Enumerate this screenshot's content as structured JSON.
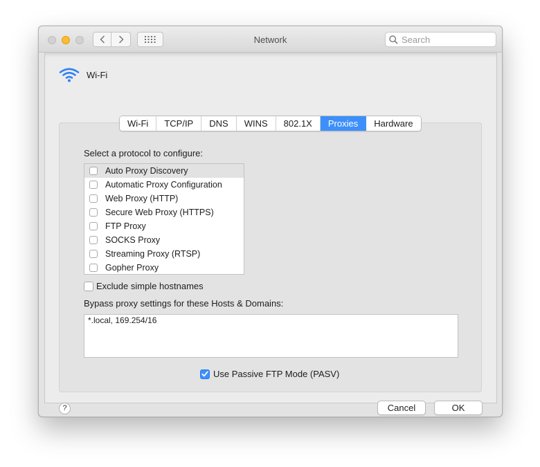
{
  "window": {
    "title": "Network",
    "search_placeholder": "Search",
    "icons": {
      "back": "chevron-left-icon",
      "forward": "chevron-right-icon",
      "show_all": "grid-icon",
      "search": "search-icon"
    }
  },
  "interface": {
    "name": "Wi-Fi",
    "icon": "wifi-icon"
  },
  "tabs": [
    {
      "label": "Wi-Fi"
    },
    {
      "label": "TCP/IP"
    },
    {
      "label": "DNS"
    },
    {
      "label": "WINS"
    },
    {
      "label": "802.1X"
    },
    {
      "label": "Proxies",
      "active": true
    },
    {
      "label": "Hardware"
    }
  ],
  "proxies": {
    "prompt": "Select a protocol to configure:",
    "protocols": [
      {
        "label": "Auto Proxy Discovery",
        "checked": false,
        "selected": true
      },
      {
        "label": "Automatic Proxy Configuration",
        "checked": false
      },
      {
        "label": "Web Proxy (HTTP)",
        "checked": false
      },
      {
        "label": "Secure Web Proxy (HTTPS)",
        "checked": false
      },
      {
        "label": "FTP Proxy",
        "checked": false
      },
      {
        "label": "SOCKS Proxy",
        "checked": false
      },
      {
        "label": "Streaming Proxy (RTSP)",
        "checked": false
      },
      {
        "label": "Gopher Proxy",
        "checked": false
      }
    ],
    "exclude_simple": {
      "label": "Exclude simple hostnames",
      "checked": false
    },
    "bypass_label": "Bypass proxy settings for these Hosts & Domains:",
    "bypass_value": "*.local, 169.254/16",
    "passive_ftp": {
      "label": "Use Passive FTP Mode (PASV)",
      "checked": true
    }
  },
  "footer": {
    "help": "?",
    "cancel": "Cancel",
    "ok": "OK"
  },
  "colors": {
    "accent": "#3d8ffb",
    "minimize": "#fdbb2e"
  }
}
